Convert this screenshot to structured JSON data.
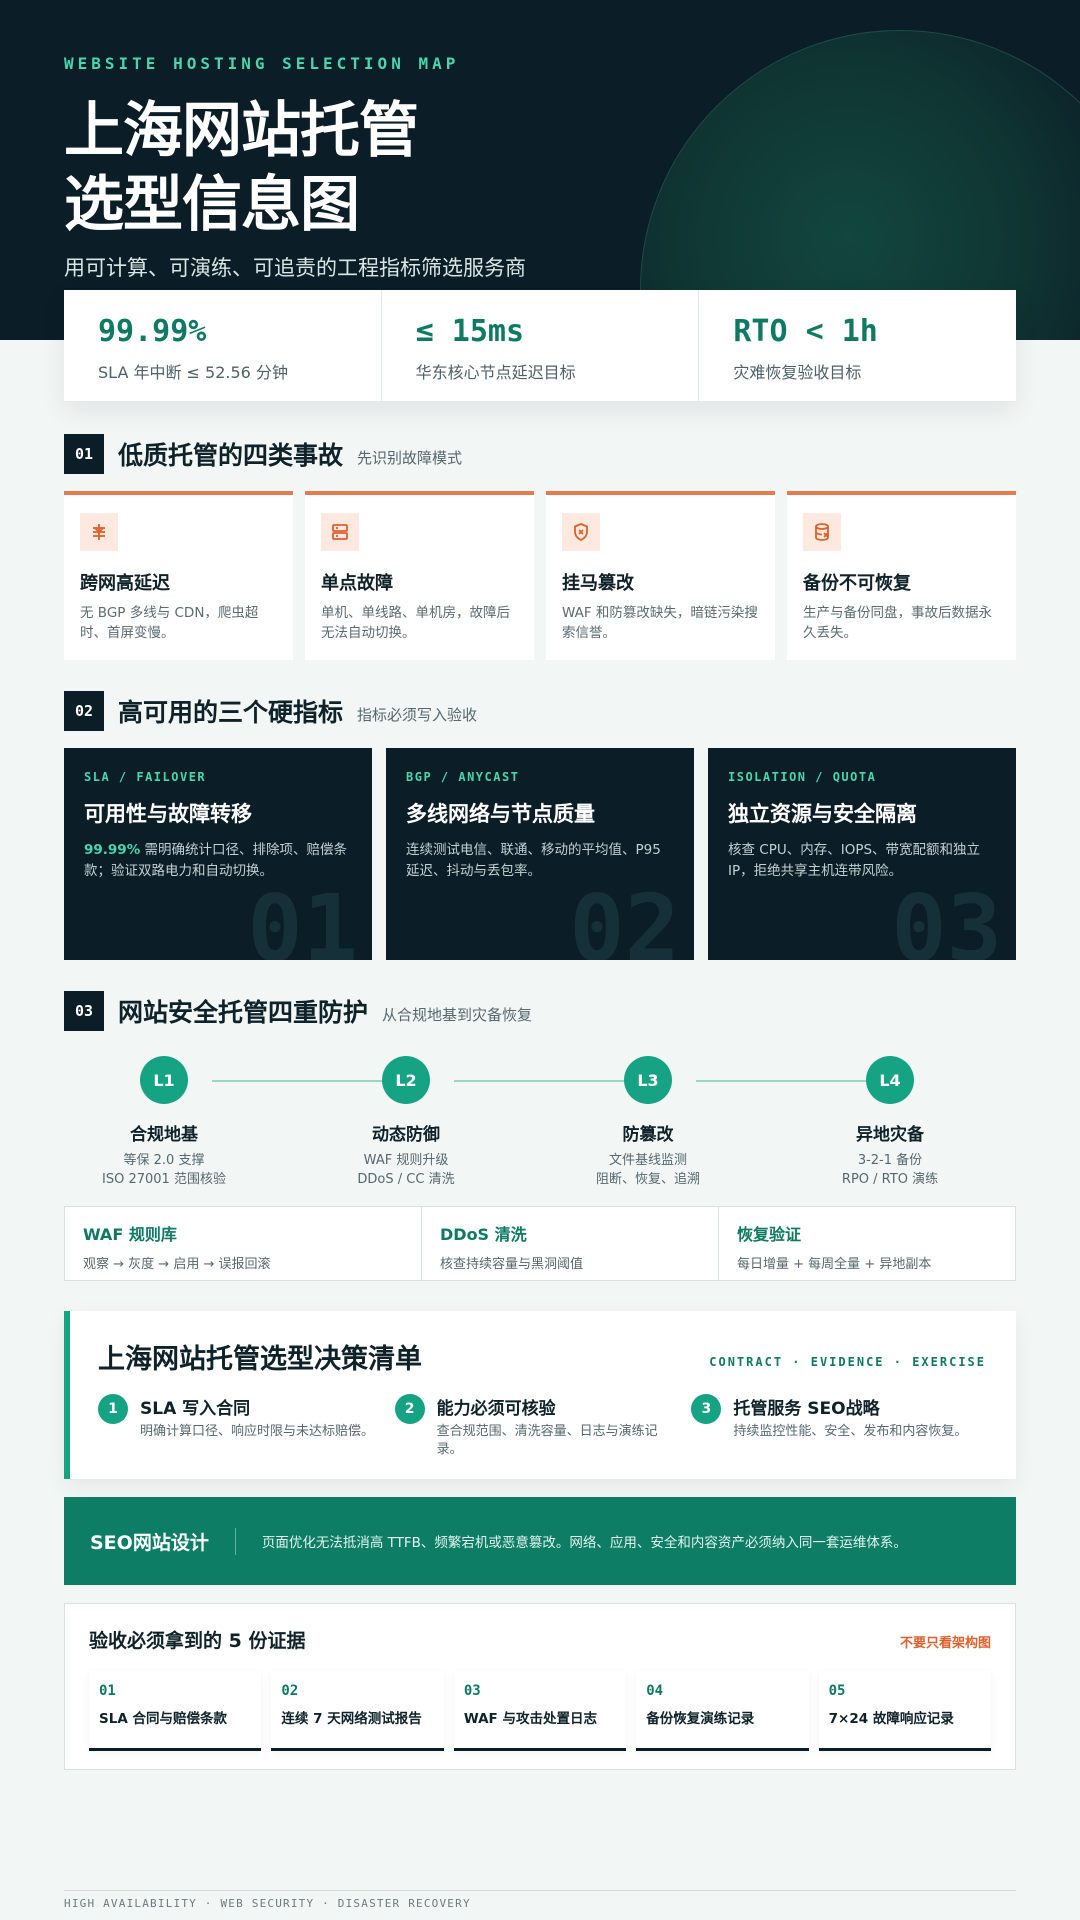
{
  "hero": {
    "eyebrow": "WEBSITE HOSTING SELECTION MAP",
    "title_line1": "上海网站托管",
    "title_line2": "选型信息图",
    "subtitle": "用可计算、可演练、可追责的工程指标筛选服务商"
  },
  "stats": [
    {
      "value": "99.99%",
      "label": "SLA 年中断 ≤ 52.56 分钟"
    },
    {
      "value": "≤ 15ms",
      "label": "华东核心节点延迟目标"
    },
    {
      "value": "RTO < 1h",
      "label": "灾难恢复验收目标"
    }
  ],
  "section1": {
    "num": "01",
    "title": "低质托管的四类事故",
    "note": "先识别故障模式",
    "cards": [
      {
        "icon": "network-icon",
        "title": "跨网高延迟",
        "desc": "无 BGP 多线与 CDN，爬虫超时、首屏变慢。"
      },
      {
        "icon": "server-icon",
        "title": "单点故障",
        "desc": "单机、单线路、单机房，故障后无法自动切换。"
      },
      {
        "icon": "shield-x-icon",
        "title": "挂马篡改",
        "desc": "WAF 和防篡改缺失，暗链污染搜索信誉。"
      },
      {
        "icon": "database-x-icon",
        "title": "备份不可恢复",
        "desc": "生产与备份同盘，事故后数据永久丢失。"
      }
    ]
  },
  "section2": {
    "num": "02",
    "title": "高可用的三个硬指标",
    "note": "指标必须写入验收",
    "cards": [
      {
        "tag": "SLA / FAILOVER",
        "title": "可用性与故障转移",
        "highlight": "99.99%",
        "desc": " 需明确统计口径、排除项、赔偿条款；验证双路电力和自动切换。",
        "num": "01"
      },
      {
        "tag": "BGP / ANYCAST",
        "title": "多线网络与节点质量",
        "highlight": "",
        "desc": "连续测试电信、联通、移动的平均值、P95 延迟、抖动与丢包率。",
        "num": "02"
      },
      {
        "tag": "ISOLATION / QUOTA",
        "title": "独立资源与安全隔离",
        "highlight": "",
        "desc": "核查 CPU、内存、IOPS、带宽配额和独立 IP，拒绝共享主机连带风险。",
        "num": "03"
      }
    ]
  },
  "section3": {
    "num": "03",
    "title": "网站安全托管四重防护",
    "note": "从合规地基到灾备恢复",
    "steps": [
      {
        "badge": "L1",
        "title": "合规地基",
        "line1": "等保 2.0 支撑",
        "line2": "ISO 27001 范围核验"
      },
      {
        "badge": "L2",
        "title": "动态防御",
        "line1": "WAF 规则升级",
        "line2": "DDoS / CC 清洗"
      },
      {
        "badge": "L3",
        "title": "防篡改",
        "line1": "文件基线监测",
        "line2": "阻断、恢复、追溯"
      },
      {
        "badge": "L4",
        "title": "异地灾备",
        "line1": "3-2-1 备份",
        "line2": "RPO / RTO 演练"
      }
    ],
    "defense": [
      {
        "title": "WAF 规则库",
        "desc": "观察 → 灰度 → 启用 → 误报回滚"
      },
      {
        "title": "DDoS 清洗",
        "desc": "核查持续容量与黑洞阈值"
      },
      {
        "title": "恢复验证",
        "desc": "每日增量 + 每周全量 + 异地副本"
      }
    ]
  },
  "checklist": {
    "title": "上海网站托管选型决策清单",
    "tag": "CONTRACT · EVIDENCE · EXERCISE",
    "items": [
      {
        "num": "1",
        "title": "SLA 写入合同",
        "desc": "明确计算口径、响应时限与未达标赔偿。"
      },
      {
        "num": "2",
        "title": "能力必须可核验",
        "desc": "查合规范围、清洗容量、日志与演练记录。"
      },
      {
        "num": "3",
        "title": "托管服务 SEO战略",
        "desc": "持续监控性能、安全、发布和内容恢复。"
      }
    ]
  },
  "seo": {
    "title": "SEO网站设计",
    "text": "页面优化无法抵消高 TTFB、频繁宕机或恶意篡改。网络、应用、安全和内容资产必须纳入同一套运维体系。"
  },
  "evidence": {
    "title": "验收必须拿到的 5 份证据",
    "note": "不要只看架构图",
    "cards": [
      {
        "num": "01",
        "label": "SLA 合同与赔偿条款"
      },
      {
        "num": "02",
        "label": "连续 7 天网络测试报告"
      },
      {
        "num": "03",
        "label": "WAF 与攻击处置日志"
      },
      {
        "num": "04",
        "label": "备份恢复演练记录"
      },
      {
        "num": "05",
        "label": "7×24 故障响应记录"
      }
    ]
  },
  "footer": "HIGH AVAILABILITY · WEB SECURITY · DISASTER RECOVERY",
  "colors": {
    "accent": "#16a383",
    "dark": "#0b1d26",
    "warn": "#e57a4c",
    "banner": "#0d7d66"
  }
}
